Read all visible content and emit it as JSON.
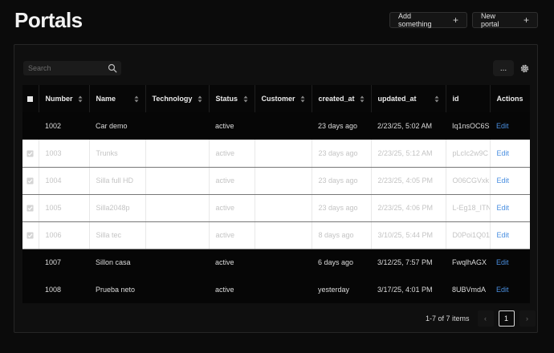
{
  "page": {
    "title": "Portals"
  },
  "header": {
    "add_label": "Add something",
    "new_label": "New portal"
  },
  "toolbar": {
    "search_placeholder": "Search",
    "more_label": "..."
  },
  "table": {
    "columns": [
      "Number",
      "Name",
      "Technology",
      "Status",
      "Customer",
      "created_at",
      "updated_at",
      "id",
      "Actions"
    ],
    "rows": [
      {
        "number": "1002",
        "name": "Car demo",
        "technology": "",
        "status": "active",
        "customer": "",
        "created_at": "23 days ago",
        "updated_at": "2/23/25, 5:02 AM",
        "id": "Iq1nsOC6S",
        "action": "Edit",
        "selected": false
      },
      {
        "number": "1003",
        "name": "Trunks",
        "technology": "",
        "status": "active",
        "customer": "",
        "created_at": "23 days ago",
        "updated_at": "2/23/25, 5:12 AM",
        "id": "pLcIc2w9C",
        "action": "Edit",
        "selected": true
      },
      {
        "number": "1004",
        "name": "Silla full HD",
        "technology": "",
        "status": "active",
        "customer": "",
        "created_at": "23 days ago",
        "updated_at": "2/23/25, 4:05 PM",
        "id": "O06CGVxk",
        "action": "Edit",
        "selected": true
      },
      {
        "number": "1005",
        "name": "Silla2048p",
        "technology": "",
        "status": "active",
        "customer": "",
        "created_at": "23 days ago",
        "updated_at": "2/23/25, 4:06 PM",
        "id": "L-Eg18_ITN",
        "action": "Edit",
        "selected": true
      },
      {
        "number": "1006",
        "name": "Silla tec",
        "technology": "",
        "status": "active",
        "customer": "",
        "created_at": "8 days ago",
        "updated_at": "3/10/25, 5:44 PM",
        "id": "D0Poi1Q01",
        "action": "Edit",
        "selected": true
      },
      {
        "number": "1007",
        "name": "Sillon casa",
        "technology": "",
        "status": "active",
        "customer": "",
        "created_at": "6 days ago",
        "updated_at": "3/12/25, 7:57 PM",
        "id": "FwqlhAGX",
        "action": "Edit",
        "selected": false
      },
      {
        "number": "1008",
        "name": "Prueba neto",
        "technology": "",
        "status": "active",
        "customer": "",
        "created_at": "yesterday",
        "updated_at": "3/17/25, 4:01 PM",
        "id": "8UBVmdA",
        "action": "Edit",
        "selected": false
      }
    ]
  },
  "pagination": {
    "info": "1-7 of 7 items",
    "prev": "‹",
    "current": "1",
    "next": "›"
  },
  "colors": {
    "accent": "#4a8fe0",
    "background": "#0b0b0b",
    "selected_row": "#ffffff"
  },
  "icons": {
    "search": "search-icon",
    "gear": "gear-icon",
    "plus": "plus-icon",
    "sort": "sort-icon",
    "checkbox": "checkbox-icon"
  }
}
